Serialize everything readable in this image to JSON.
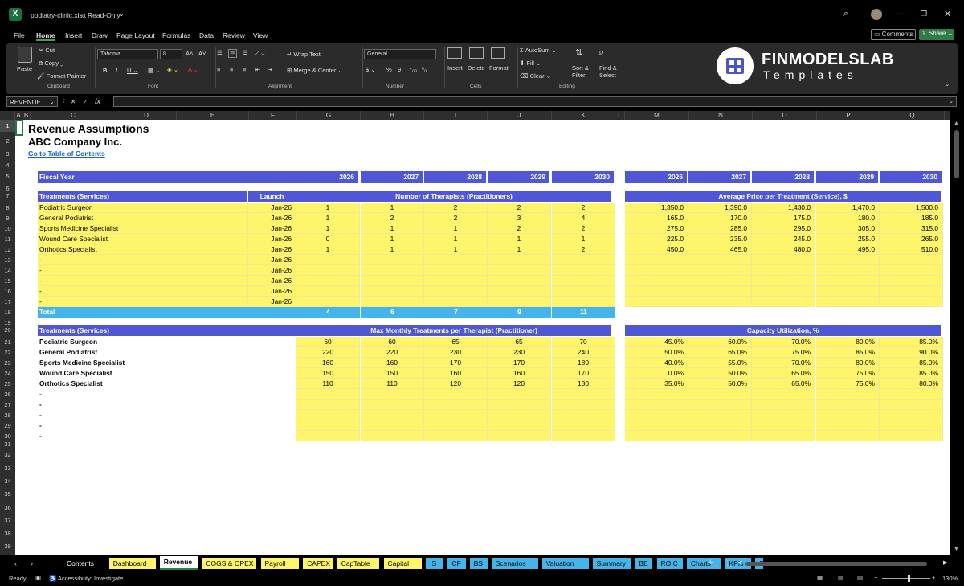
{
  "window": {
    "filename": "podiatry-clinic.xlsx",
    "mode": "Read-Only"
  },
  "menu": [
    "File",
    "Home",
    "Insert",
    "Draw",
    "Page Layout",
    "Formulas",
    "Data",
    "Review",
    "View"
  ],
  "menu_right": {
    "comments": "Comments",
    "share": "Share"
  },
  "ribbon": {
    "paste": "Paste",
    "cut": "Cut",
    "copy": "Copy",
    "format_painter": "Format Painter",
    "clipboard": "Clipboard",
    "font_name": "Tahoma",
    "font_size": "8",
    "font": "Font",
    "wrap_text": "Wrap Text",
    "merge_center": "Merge & Center",
    "alignment": "Alignment",
    "number_format": "General",
    "number": "Number",
    "insert": "Insert",
    "delete": "Delete",
    "format": "Format",
    "cells": "Cells",
    "autosum": "AutoSum",
    "fill": "Fill",
    "clear": "Clear",
    "sort_filter": "Sort & Filter",
    "find_select": "Find & Select",
    "editing": "Editing",
    "brand_name": "FINMODELSLAB",
    "brand_sub": "Templates"
  },
  "formula_bar": {
    "name_box": "REVENUE",
    "fx": "fx",
    "formula": ""
  },
  "columns": [
    "A",
    "B",
    "C",
    "D",
    "E",
    "F",
    "G",
    "H",
    "I",
    "J",
    "K",
    "L",
    "M",
    "N",
    "O",
    "P",
    "Q"
  ],
  "rows": [
    "1",
    "2",
    "3",
    "4",
    "5",
    "6",
    "7",
    "8",
    "9",
    "10",
    "11",
    "12",
    "13",
    "14",
    "15",
    "16",
    "17",
    "18",
    "19",
    "20",
    "21",
    "22",
    "23",
    "24",
    "25",
    "26",
    "27",
    "28",
    "29",
    "30",
    "31",
    "32",
    "33",
    "34",
    "35",
    "36",
    "37",
    "38",
    "39"
  ],
  "sheet": {
    "title": "Revenue Assumptions",
    "company": "ABC Company Inc.",
    "toc_link": "Go to Table of Contents",
    "fiscal_year_label": "Fiscal Year",
    "years": [
      "2026",
      "2027",
      "2028",
      "2029",
      "2030"
    ],
    "treatments_header": "Treatments (Services)",
    "launch_header": "Launch",
    "therapists_header": "Number of Therapists (Practitioners)",
    "price_header": "Average Price per Treatment (Service), $",
    "services": [
      {
        "name": "Podiatric Surgeon",
        "launch": "Jan-26",
        "therapists": [
          "1",
          "1",
          "2",
          "2",
          "2"
        ],
        "price": [
          "1,350.0",
          "1,390.0",
          "1,430.0",
          "1,470.0",
          "1,500.0"
        ]
      },
      {
        "name": "General Podiatrist",
        "launch": "Jan-26",
        "therapists": [
          "1",
          "2",
          "2",
          "3",
          "4"
        ],
        "price": [
          "165.0",
          "170.0",
          "175.0",
          "180.0",
          "185.0"
        ]
      },
      {
        "name": "Sports Medicine Specialist",
        "launch": "Jan-26",
        "therapists": [
          "1",
          "1",
          "1",
          "2",
          "2"
        ],
        "price": [
          "275.0",
          "285.0",
          "295.0",
          "305.0",
          "315.0"
        ]
      },
      {
        "name": "Wound Care Specialist",
        "launch": "Jan-26",
        "therapists": [
          "0",
          "1",
          "1",
          "1",
          "1"
        ],
        "price": [
          "225.0",
          "235.0",
          "245.0",
          "255.0",
          "265.0"
        ]
      },
      {
        "name": "Orthotics Specialist",
        "launch": "Jan-26",
        "therapists": [
          "1",
          "1",
          "1",
          "1",
          "2"
        ],
        "price": [
          "450.0",
          "465.0",
          "480.0",
          "495.0",
          "510.0"
        ]
      },
      {
        "name": "-",
        "launch": "Jan-26",
        "therapists": [
          "",
          "",
          "",
          "",
          ""
        ],
        "price": [
          "",
          "",
          "",
          "",
          ""
        ]
      },
      {
        "name": "-",
        "launch": "Jan-26",
        "therapists": [
          "",
          "",
          "",
          "",
          ""
        ],
        "price": [
          "",
          "",
          "",
          "",
          ""
        ]
      },
      {
        "name": "-",
        "launch": "Jan-26",
        "therapists": [
          "",
          "",
          "",
          "",
          ""
        ],
        "price": [
          "",
          "",
          "",
          "",
          ""
        ]
      },
      {
        "name": "-",
        "launch": "Jan-26",
        "therapists": [
          "",
          "",
          "",
          "",
          ""
        ],
        "price": [
          "",
          "",
          "",
          "",
          ""
        ]
      },
      {
        "name": "-",
        "launch": "Jan-26",
        "therapists": [
          "",
          "",
          "",
          "",
          ""
        ],
        "price": [
          "",
          "",
          "",
          "",
          ""
        ]
      }
    ],
    "total_label": "Total",
    "totals": [
      "4",
      "6",
      "7",
      "9",
      "11"
    ],
    "max_header": "Max Monthly Treatments per Therapist (Practitioner)",
    "util_header": "Capacity Utilization, %",
    "services2": [
      {
        "name": "Podiatric Surgeon",
        "max": [
          "60",
          "60",
          "65",
          "65",
          "70"
        ],
        "util": [
          "45.0%",
          "60.0%",
          "70.0%",
          "80.0%",
          "85.0%"
        ]
      },
      {
        "name": "General Podiatrist",
        "max": [
          "220",
          "220",
          "230",
          "230",
          "240"
        ],
        "util": [
          "50.0%",
          "65.0%",
          "75.0%",
          "85.0%",
          "90.0%"
        ]
      },
      {
        "name": "Sports Medicine Specialist",
        "max": [
          "160",
          "160",
          "170",
          "170",
          "180"
        ],
        "util": [
          "40.0%",
          "55.0%",
          "70.0%",
          "80.0%",
          "85.0%"
        ]
      },
      {
        "name": "Wound Care Specialist",
        "max": [
          "150",
          "150",
          "160",
          "160",
          "170"
        ],
        "util": [
          "0.0%",
          "50.0%",
          "65.0%",
          "75.0%",
          "85.0%"
        ]
      },
      {
        "name": "Orthotics Specialist",
        "max": [
          "110",
          "110",
          "120",
          "120",
          "130"
        ],
        "util": [
          "35.0%",
          "50.0%",
          "65.0%",
          "75.0%",
          "80.0%"
        ]
      },
      {
        "name": "-",
        "max": [
          "",
          "",
          "",
          "",
          ""
        ],
        "util": [
          "",
          "",
          "",
          "",
          ""
        ]
      },
      {
        "name": "-",
        "max": [
          "",
          "",
          "",
          "",
          ""
        ],
        "util": [
          "",
          "",
          "",
          "",
          ""
        ]
      },
      {
        "name": "-",
        "max": [
          "",
          "",
          "",
          "",
          ""
        ],
        "util": [
          "",
          "",
          "",
          "",
          ""
        ]
      },
      {
        "name": "-",
        "max": [
          "",
          "",
          "",
          "",
          ""
        ],
        "util": [
          "",
          "",
          "",
          "",
          ""
        ]
      },
      {
        "name": "-",
        "max": [
          "",
          "",
          "",
          "",
          ""
        ],
        "util": [
          "",
          "",
          "",
          "",
          ""
        ]
      }
    ]
  },
  "tabs": [
    {
      "label": "Contents",
      "color": "#000000",
      "text": "#ffffff"
    },
    {
      "label": "Dashboard",
      "color": "#fff56b",
      "text": "#000000"
    },
    {
      "label": "Revenue",
      "color": "#ffffff",
      "text": "#000000",
      "active": true
    },
    {
      "label": "COGS & OPEX",
      "color": "#fff56b",
      "text": "#000000"
    },
    {
      "label": "Payroll",
      "color": "#fff56b",
      "text": "#000000"
    },
    {
      "label": "CAPEX",
      "color": "#fff56b",
      "text": "#000000"
    },
    {
      "label": "CapTable",
      "color": "#fff56b",
      "text": "#000000"
    },
    {
      "label": "Capital",
      "color": "#fff56b",
      "text": "#000000"
    },
    {
      "label": "IS",
      "color": "#44b5ea",
      "text": "#000000"
    },
    {
      "label": "CF",
      "color": "#44b5ea",
      "text": "#000000"
    },
    {
      "label": "BS",
      "color": "#44b5ea",
      "text": "#000000"
    },
    {
      "label": "Scenarios",
      "color": "#44b5ea",
      "text": "#000000"
    },
    {
      "label": "Valuation",
      "color": "#44b5ea",
      "text": "#000000"
    },
    {
      "label": "Summary",
      "color": "#44b5ea",
      "text": "#000000"
    },
    {
      "label": "BE",
      "color": "#44b5ea",
      "text": "#000000"
    },
    {
      "label": "ROIC",
      "color": "#44b5ea",
      "text": "#000000"
    },
    {
      "label": "Charts",
      "color": "#44b5ea",
      "text": "#000000"
    },
    {
      "label": "KPIs",
      "color": "#44b5ea",
      "text": "#000000"
    },
    {
      "label": "Sc",
      "color": "#44b5ea",
      "text": "#000000"
    }
  ],
  "status": {
    "ready": "Ready",
    "accessibility": "Accessibility: Investigate",
    "zoom": "130%"
  },
  "colors": {
    "header_blue": "#4f57d6",
    "input_yellow": "#fff56b",
    "total_blue": "#44b5ea",
    "link_blue": "#1a5fd6"
  }
}
